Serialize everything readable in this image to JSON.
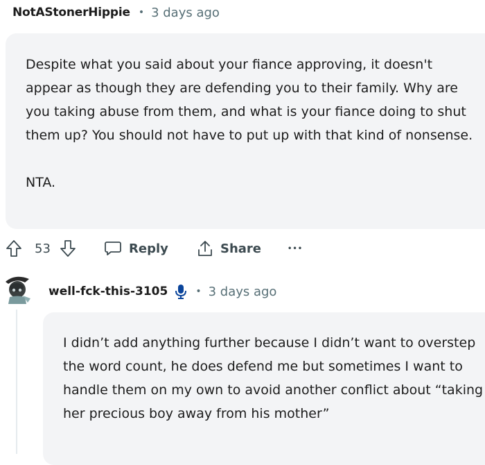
{
  "comment1": {
    "author": "NotAStonerHippie",
    "separator": "•",
    "time": "3 days ago",
    "paragraphs": [
      "Despite what you said about your fiance approving, it doesn't appear as though they are defending you to their family. Why are you taking abuse from them, and what is your fiance doing to shut them up? You should not have to put up with that kind of nonsense.",
      "NTA."
    ],
    "actions": {
      "upvote_icon": "upvote-arrow-icon",
      "score": "53",
      "downvote_icon": "downvote-arrow-icon",
      "reply_label": "Reply",
      "share_label": "Share",
      "more_label": "•••"
    }
  },
  "comment2": {
    "author": "well-fck-this-3105",
    "badge_icon": "microphone-icon",
    "separator": "•",
    "time": "3 days ago",
    "body": "I didn’t add anything further because I didn’t want to overstep the word count, he does defend me but sometimes I want to handle them on my own to avoid another conflict about “taking her precious boy away from his mother”"
  },
  "colors": {
    "bubble_bg": "#f3f4f6",
    "meta_text": "#576f76",
    "action_text": "#3c4a50",
    "mic_blue": "#0a449b"
  }
}
